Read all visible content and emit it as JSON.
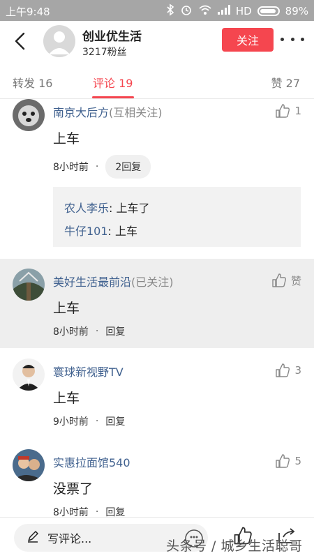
{
  "status_bar": {
    "time": "上午9:48",
    "network": "HD",
    "battery": "89%"
  },
  "header": {
    "name": "创业优生活",
    "fans": "3217粉丝",
    "follow_label": "关注"
  },
  "tabs": [
    {
      "label": "转发 16"
    },
    {
      "label": "评论 19"
    },
    {
      "label": "赞 27"
    }
  ],
  "comments": [
    {
      "name": "南京大后方",
      "relation": "(互相关注)",
      "like_text": "1",
      "text": "上车",
      "time": "8小时前",
      "reply_label": "2回复",
      "replies": [
        {
          "user": "农人李乐",
          "text": ": 上车了"
        },
        {
          "user": "牛仔101",
          "text": ": 上车"
        }
      ]
    },
    {
      "name": "美好生活最前沿",
      "relation": "(已关注)",
      "like_text": "赞",
      "text": "上车",
      "time": "8小时前",
      "reply_label": "回复"
    },
    {
      "name": "寰球新视野TV",
      "like_text": "3",
      "text": "上车",
      "time": "9小时前",
      "reply_label": "回复"
    },
    {
      "name": "实惠拉面馆540",
      "like_text": "5",
      "text": "没票了",
      "time": "8小时前",
      "reply_label": "回复"
    }
  ],
  "bottom_bar": {
    "write_placeholder": "写评论...",
    "watermark": "头条号 / 城乡生活聪哥"
  },
  "colors": {
    "accent": "#f5464f",
    "link": "#40618f",
    "highlight_bg": "#eeeeee"
  }
}
